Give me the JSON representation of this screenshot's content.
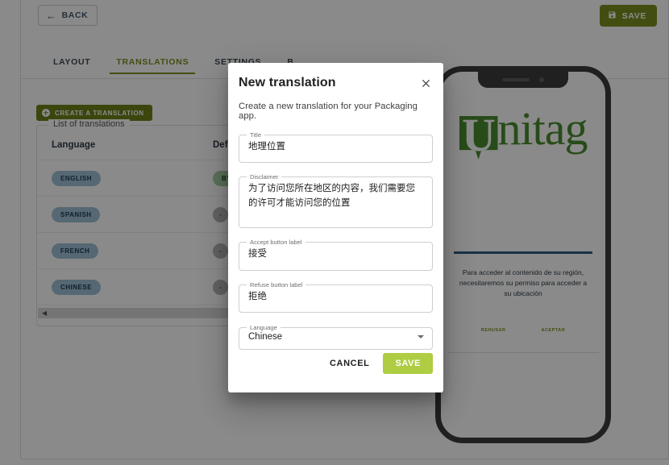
{
  "topbar": {
    "back_label": "BACK",
    "back_icon": "arrow-left-icon",
    "save_label": "SAVE",
    "save_icon": "floppy-disk-icon",
    "save_color": "#7a9020"
  },
  "tabs": [
    {
      "label": "LAYOUT",
      "active": false
    },
    {
      "label": "TRANSLATIONS",
      "active": true
    },
    {
      "label": "SETTINGS",
      "active": false
    },
    {
      "label": "B",
      "active": false
    }
  ],
  "left_panel": {
    "create_button_label": "CREATE A TRANSLATION",
    "create_button_icon": "plus-circle-icon",
    "list_legend": "List of translations",
    "columns": [
      "Language",
      "Default"
    ],
    "rows": [
      {
        "language": "ENGLISH",
        "default": "BY DEFAULT",
        "is_default": true
      },
      {
        "language": "SPANISH",
        "default": "-",
        "is_default": false
      },
      {
        "language": "FRENCH",
        "default": "-",
        "is_default": false
      },
      {
        "language": "CHINESE",
        "default": "-",
        "is_default": false
      }
    ],
    "scroll_arrow": "◀"
  },
  "phone_preview": {
    "logo_letter": "U",
    "logo_text": "nitag",
    "message": "Para acceder al contenido de su región, necesitaremos su permiso para acceder a su ubicación",
    "refuse_label": "REHUSAR",
    "accept_label": "ACEPTAR",
    "accent_color": "#2d5d86"
  },
  "dialog": {
    "title": "New translation",
    "close_icon": "close-icon",
    "subtitle": "Create a new translation for your Packaging app.",
    "fields": [
      {
        "label": "Title",
        "value": "地理位置"
      },
      {
        "label": "Disclaimer",
        "value": "为了访问您所在地区的内容，我们需要您的许可才能访问您的位置"
      },
      {
        "label": "Accept button label",
        "value": "接受"
      },
      {
        "label": "Refuse button label",
        "value": "拒绝"
      }
    ],
    "language_field": {
      "label": "Language",
      "value": "Chinese",
      "caret_icon": "chevron-down-icon"
    },
    "cancel_label": "CANCEL",
    "save_label": "SAVE",
    "save_color": "#aecd43"
  }
}
